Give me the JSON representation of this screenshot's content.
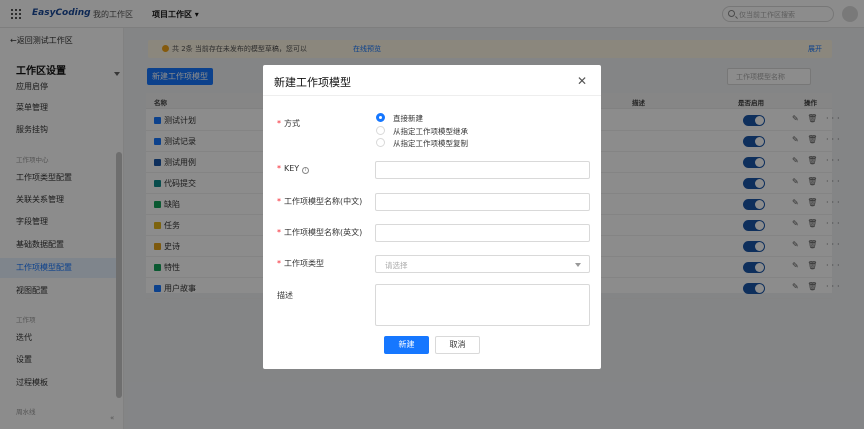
{
  "topbar": {
    "logo": "EasyCoding",
    "nav_mine": "我的工作区",
    "nav_project": "项目工作区 ▾",
    "search_placeholder": "仅当前工作区搜索"
  },
  "sidebar": {
    "back": "←返回测试工作区",
    "title": "工作区设置",
    "items_top": [
      {
        "label": "应用启停"
      },
      {
        "label": "菜单管理"
      },
      {
        "label": "服务挂钩"
      }
    ],
    "group1": "工作项中心",
    "items_mid": [
      {
        "label": "工作项类型配置"
      },
      {
        "label": "关联关系管理"
      },
      {
        "label": "字段管理"
      },
      {
        "label": "基础数据配置"
      },
      {
        "label": "工作项模型配置",
        "active": true
      },
      {
        "label": "视图配置"
      }
    ],
    "group2": "工作项",
    "items_bottom": [
      {
        "label": "迭代"
      },
      {
        "label": "设置"
      },
      {
        "label": "过程模板"
      }
    ],
    "group3": "周水线",
    "collapse": "«"
  },
  "notice": {
    "text": "共 2条 当前存在未发布的模型草稿，您可以",
    "link": "在线预览",
    "expand": "展开"
  },
  "toolbar": {
    "new_button": "新建工作项模型",
    "filter_placeholder": "工作项模型名称"
  },
  "table": {
    "headers": {
      "name": "名称",
      "desc": "描述",
      "enabled": "是否启用",
      "ops": "操作"
    },
    "rows": [
      {
        "name": "测试计划",
        "icon_color": "#1677ff"
      },
      {
        "name": "测试记录",
        "icon_color": "#1677ff"
      },
      {
        "name": "测试用例",
        "icon_color": "#1a56a8"
      },
      {
        "name": "代码提交",
        "icon_color": "#0f8a8a"
      },
      {
        "name": "缺陷",
        "icon_color": "#13a35a"
      },
      {
        "name": "任务",
        "icon_color": "#e3b41b"
      },
      {
        "name": "史诗",
        "icon_color": "#e3a21b"
      },
      {
        "name": "特性",
        "icon_color": "#13a35a"
      },
      {
        "name": "用户故事",
        "icon_color": "#1677ff"
      }
    ],
    "ops_glyphs": "✎ 🗑 ···"
  },
  "modal": {
    "title": "新建工作项模型",
    "close": "✕",
    "method_label": "方式",
    "method_options": [
      "直接新建",
      "从指定工作项模型继承",
      "从指定工作项模型复制"
    ],
    "key_label": "KEY",
    "key_info": "i",
    "name_cn_label": "工作项模型名称(中文)",
    "name_en_label": "工作项模型名称(英文)",
    "type_label": "工作项类型",
    "type_placeholder": "请选择",
    "desc_label": "描述",
    "ok": "新建",
    "cancel": "取消"
  },
  "colors": {
    "primary": "#1677ff",
    "required": "#f5222d",
    "toggle": "#1a56a8"
  }
}
